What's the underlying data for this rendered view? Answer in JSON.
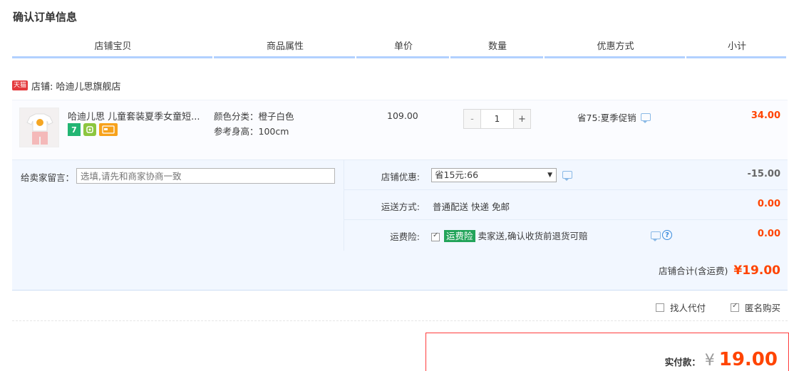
{
  "page_title": "确认订单信息",
  "columns": [
    "店铺宝贝",
    "商品属性",
    "单价",
    "数量",
    "优惠方式",
    "小计"
  ],
  "shop": {
    "badge": "天猫",
    "label": "店铺: 哈迪儿思旗舰店"
  },
  "item": {
    "title": "哈迪儿思 儿童套装夏季女童短...",
    "badges": [
      {
        "text": "7",
        "color": "#22b573"
      },
      {
        "text": "",
        "color": "#8cc63f"
      },
      {
        "text": "",
        "color": "#f7a21b"
      }
    ],
    "attr_color": "颜色分类：橙子白色",
    "attr_size": "参考身高：100cm",
    "price": "109.00",
    "quantity": {
      "minus": "-",
      "value": "1",
      "plus": "+"
    },
    "promo": "省75:夏季促销",
    "subtotal": "34.00"
  },
  "message": {
    "label": "给卖家留言：",
    "placeholder": "选填,请先和商家协商一致"
  },
  "shop_discount": {
    "label": "店铺优惠:",
    "selected": "省15元:66",
    "amount": "-15.00"
  },
  "shipping": {
    "label": "运送方式:",
    "value": "普通配送 快递 免邮",
    "amount": "0.00"
  },
  "insurance": {
    "label": "运费险:",
    "badge": "运费险",
    "text": "卖家送,确认收货前退货可赔",
    "help": "?",
    "amount": "0.00"
  },
  "shop_total": {
    "label": "店铺合计(含运费)",
    "amount": "¥19.00"
  },
  "options": [
    {
      "label": "找人代付",
      "checked": false
    },
    {
      "label": "匿名购买",
      "checked": true
    }
  ],
  "payment": {
    "label": "实付款：",
    "currency": "¥",
    "amount": "19.00"
  },
  "colors": {
    "accent": "#ff4400",
    "header_underline": "#b2d1ff",
    "panel_bg": "#f2f7ff"
  }
}
